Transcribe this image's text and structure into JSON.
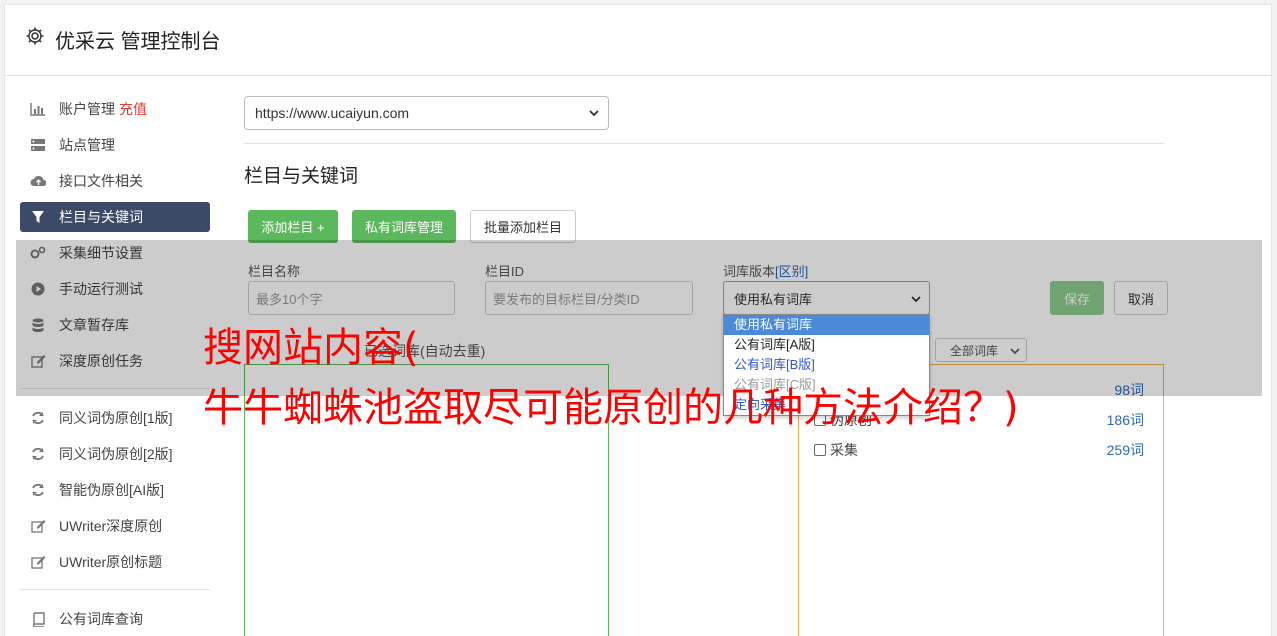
{
  "app": {
    "title": "优采云 管理控制台",
    "icon": "gear-icon"
  },
  "sidebar": {
    "items": [
      {
        "label": "账户管理",
        "icon": "bar-chart-icon",
        "badge": "充值"
      },
      {
        "label": "站点管理",
        "icon": "server-icon"
      },
      {
        "label": "接口文件相关",
        "icon": "cloud-upload-icon"
      },
      {
        "label": "栏目与关键词",
        "icon": "filter-icon",
        "active": true
      },
      {
        "label": "采集细节设置",
        "icon": "gears-icon"
      },
      {
        "label": "手动运行测试",
        "icon": "play-circle-icon"
      },
      {
        "label": "文章暂存库",
        "icon": "database-icon"
      },
      {
        "label": "深度原创任务",
        "icon": "edit-icon"
      }
    ],
    "items2": [
      {
        "label": "同义词伪原创[1版]",
        "icon": "refresh-icon"
      },
      {
        "label": "同义词伪原创[2版]",
        "icon": "refresh-icon"
      },
      {
        "label": "智能伪原创[AI版]",
        "icon": "refresh-icon"
      },
      {
        "label": "UWriter深度原创",
        "icon": "edit-icon"
      },
      {
        "label": "UWriter原创标题",
        "icon": "edit-icon"
      }
    ],
    "items3": [
      {
        "label": "公有词库查询",
        "icon": "book-icon"
      }
    ]
  },
  "main": {
    "site_select": {
      "value": "https://www.ucaiyun.com"
    },
    "section_title": "栏目与关键词",
    "buttons": {
      "add_column": "添加栏目 +",
      "private_lib": "私有词库管理",
      "batch_add": "批量添加栏目",
      "save": "保存",
      "cancel": "取消"
    },
    "form": {
      "name_label": "栏目名称",
      "name_placeholder": "最多10个字",
      "id_label": "栏目ID",
      "id_placeholder": "要发布的目标栏目/分类ID",
      "version_label": "词库版本",
      "version_link": "[区别]",
      "version_value": "使用私有词库",
      "version_options": [
        "使用私有词库",
        "公有词库[A版]",
        "公有词库[B版]",
        "公有词库[C版]",
        "定向采集"
      ]
    },
    "keywords_label": "已选词库(自动去重)",
    "lib_filter": "全部词库",
    "libraries": [
      {
        "name": "",
        "count": "98词"
      },
      {
        "name": "伪原创",
        "count": "186词"
      },
      {
        "name": "采集",
        "count": "259词"
      }
    ]
  },
  "overlay": {
    "line1": "搜网站内容(",
    "line2": "牛牛蜘蛛池盗取尽可能原创的几种方法介绍？)"
  },
  "colors": {
    "accent_green": "#5cb85c",
    "active_nav": "#3b4a66",
    "overlay_text": "#ff0000",
    "link_blue": "#2f6ab5"
  }
}
